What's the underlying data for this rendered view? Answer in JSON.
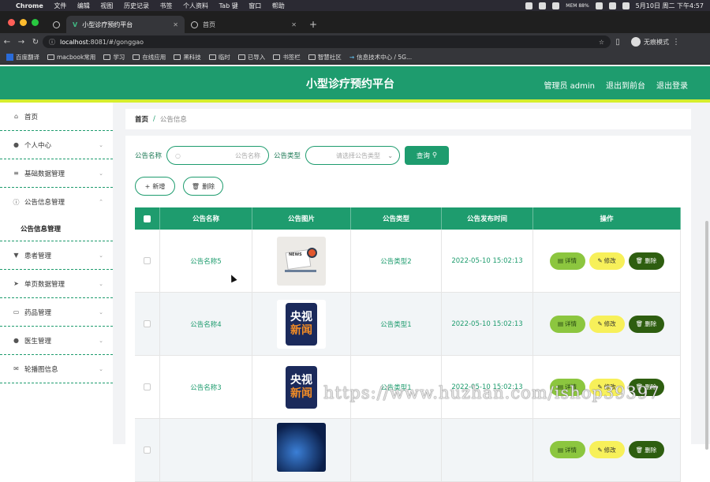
{
  "macbar": {
    "app": "Chrome",
    "menus": [
      "文件",
      "编辑",
      "视图",
      "历史记录",
      "书签",
      "个人资料",
      "Tab 键",
      "窗口",
      "帮助"
    ],
    "clock": "5月10日 周二 下午4:57",
    "mem": "MEM 88%"
  },
  "browser": {
    "tabs": [
      {
        "label": "小型诊疗预约平台",
        "icon": "vue-icon"
      },
      {
        "label": "首页",
        "icon": "globe-icon"
      }
    ],
    "url_host": "localhost",
    "url_rest": ":8081/#/gonggao",
    "incognito_label": "无痕模式",
    "bookmarks": [
      "百度翻译",
      "macbook常用",
      "学习",
      "在线应用",
      "黑科技",
      "临时",
      "已导入",
      "书签栏",
      "智慧社区",
      "信息技术中心 / 5G..."
    ]
  },
  "header": {
    "title": "小型诊疗预约平台",
    "user": "管理员 admin",
    "to_front": "退出到前台",
    "logout": "退出登录"
  },
  "sidebar": {
    "items": [
      {
        "label": "首页",
        "icon": "home-icon",
        "chevron": false
      },
      {
        "label": "个人中心",
        "icon": "user-icon",
        "chevron": true
      },
      {
        "label": "基础数据管理",
        "icon": "sliders-icon",
        "chevron": true
      },
      {
        "label": "公告信息管理",
        "icon": "info-icon",
        "chevron": true,
        "expanded": true
      },
      {
        "label": "患者管理",
        "icon": "patient-icon",
        "chevron": true
      },
      {
        "label": "单页数据管理",
        "icon": "send-icon",
        "chevron": true
      },
      {
        "label": "药品管理",
        "icon": "message-icon",
        "chevron": true
      },
      {
        "label": "医生管理",
        "icon": "doctor-icon",
        "chevron": true
      },
      {
        "label": "轮播图信息",
        "icon": "mail-icon",
        "chevron": true
      }
    ],
    "sub_item": "公告信息管理"
  },
  "breadcrumb": {
    "home": "首页",
    "sep": "/",
    "current": "公告信息"
  },
  "search": {
    "name_label": "公告名称",
    "name_placeholder": "公告名称",
    "type_label": "公告类型",
    "type_placeholder": "请选择公告类型",
    "query_btn": "查询"
  },
  "actions": {
    "add": "新增",
    "delete": "删除"
  },
  "table": {
    "headers": [
      "公告名称",
      "公告图片",
      "公告类型",
      "公告发布时间",
      "操作"
    ],
    "rows": [
      {
        "name": "公告名称5",
        "type": "公告类型2",
        "time": "2022-05-10 15:02:13",
        "img": "news"
      },
      {
        "name": "公告名称4",
        "type": "公告类型1",
        "time": "2022-05-10 15:02:13",
        "img": "cctv"
      },
      {
        "name": "公告名称3",
        "type": "公告类型1",
        "time": "2022-05-10 15:02:13",
        "img": "cctv"
      },
      {
        "name": "",
        "type": "",
        "time": "",
        "img": "blue"
      }
    ],
    "ops": {
      "detail": "详情",
      "edit": "修改",
      "del": "删除"
    }
  },
  "thumb_texts": {
    "news": "NEWS",
    "cctv_1": "央视",
    "cctv_2": "新闻"
  },
  "watermark": "https://www.huzhan.com/ishop39397",
  "colors": {
    "primary": "#1e9c6e",
    "accent_line": "#d6ee2c",
    "detail": "#8cc63f",
    "edit": "#f7f05a",
    "del": "#2e5e10"
  }
}
